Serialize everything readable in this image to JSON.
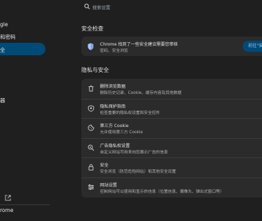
{
  "sidebar": {
    "items": [
      {
        "label": "gle"
      },
      {
        "label": "和密码"
      },
      {
        "label": "全",
        "active": true
      },
      {
        "label": "器"
      },
      {
        "label": "rome"
      }
    ]
  },
  "search": {
    "placeholder": "搜索设置"
  },
  "safety_check": {
    "section_title": "安全检查",
    "title": "Chrome 找到了一些安全建议需要您审核",
    "subtitle": "密码、安全浏览",
    "button_label": "前往\"安"
  },
  "privacy": {
    "section_title": "隐私与安全",
    "rows": [
      {
        "icon": "trash-icon",
        "title": "删除浏览数据",
        "subtitle": "删除历史记录、Cookie、缓存内容及其他数据"
      },
      {
        "icon": "privacy-guide-icon",
        "title": "隐私保护指南",
        "subtitle": "检查重要的隐私权设置和安全控件"
      },
      {
        "icon": "cookie-icon",
        "title": "第三方 Cookie",
        "subtitle": "允许使用第三方 Cookie"
      },
      {
        "icon": "ad-privacy-icon",
        "title": "广告隐私权设置",
        "subtitle": "自定义网站可用来向您展示广告的信息"
      },
      {
        "icon": "lock-icon",
        "title": "安全",
        "subtitle": "安全浏览（防范危险网站）和其他安全设置"
      },
      {
        "icon": "tune-icon",
        "title": "网站设置",
        "subtitle": "控制网站可以使用和显示的信息（位置信息、摄像头、弹出式窗口等）"
      }
    ]
  },
  "colors": {
    "accent": "#004a77",
    "accent_text": "#a8c7fa",
    "card": "#2b2b2b",
    "background": "#1f1f1f"
  }
}
